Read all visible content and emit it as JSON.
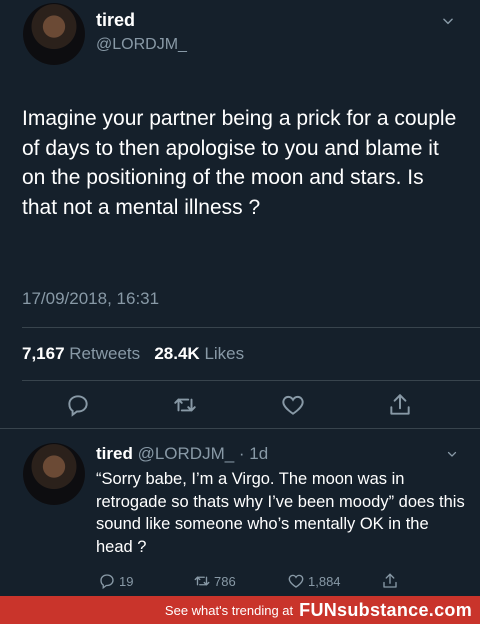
{
  "main_tweet": {
    "display_name": "tired",
    "handle": "@LORDJM_",
    "text": "Imagine your partner being a prick for a couple of days to then apologise to you and blame it on the positioning of the moon and stars. Is that not a mental illness ?",
    "timestamp": "17/09/2018, 16:31",
    "retweets_count": "7,167",
    "retweets_label": "Retweets",
    "likes_count": "28.4K",
    "likes_label": "Likes"
  },
  "reply": {
    "display_name": "tired",
    "handle_time": "@LORDJM_ · 1d",
    "text": "“Sorry babe, I’m a Virgo. The moon was in retrogade so thats why I’ve been moody” does this sound like someone who’s mentally OK in the head ?",
    "reply_count": "19",
    "retweet_count": "786",
    "like_count": "1,884"
  },
  "banner": {
    "text": "See what's trending at",
    "logo": "FUNsubstance.com"
  },
  "colors": {
    "background": "#15202b",
    "secondary_text": "#8899a6",
    "divider": "#38444d",
    "banner": "#c9342b"
  }
}
